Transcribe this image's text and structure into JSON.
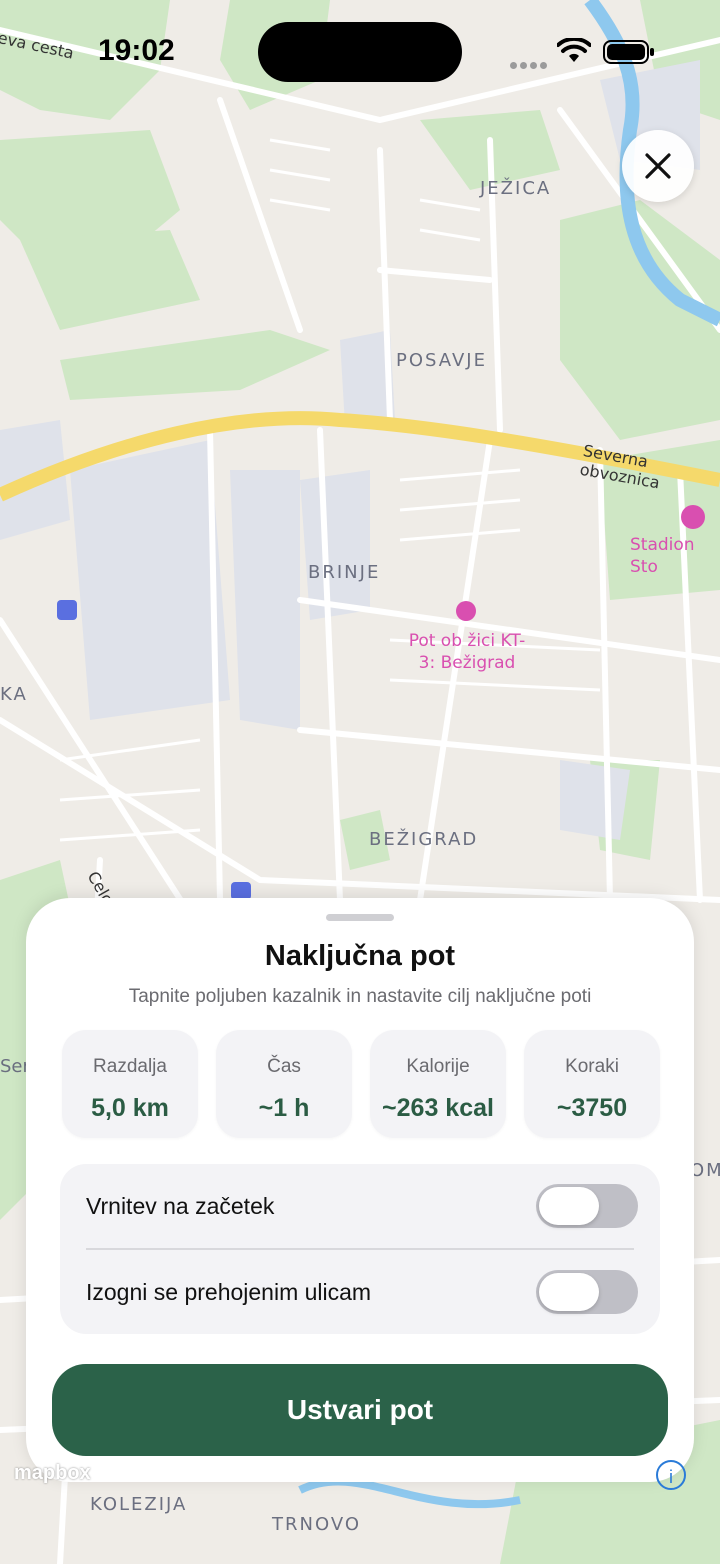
{
  "status_bar": {
    "time": "19:02"
  },
  "map": {
    "district_labels": [
      "JEŽICA",
      "POSAVJE",
      "BRINJE",
      "BEŽIGRAD",
      "KOLEZIJA",
      "TRNOVO"
    ],
    "road_labels": [
      "Severna obvoznica",
      "Celo",
      "eva cesta"
    ],
    "poi_labels": [
      "Stadion Sto",
      "Pot ob žici KT-\n3: Bežigrad"
    ],
    "edge_labels": [
      "KA",
      "Sens",
      "OMA"
    ],
    "colors": {
      "background": "#efece7",
      "park": "#cfe7c5",
      "industrial": "#dfe2ea",
      "highway": "#f5d96b",
      "river": "#8ec8ee"
    }
  },
  "close_button": {
    "icon": "close-icon"
  },
  "sheet": {
    "title": "Naključna pot",
    "subtitle": "Tapnite poljuben kazalnik in nastavite cilj naključne poti",
    "stats": [
      {
        "label": "Razdalja",
        "value": "5,0 km"
      },
      {
        "label": "Čas",
        "value": "~1 h"
      },
      {
        "label": "Kalorije",
        "value": "~263 kcal"
      },
      {
        "label": "Koraki",
        "value": "~3750"
      }
    ],
    "options": [
      {
        "label": "Vrnitev na začetek",
        "enabled": false
      },
      {
        "label": "Izogni se prehojenim ulicam",
        "enabled": false
      }
    ],
    "primary_button": "Ustvari pot",
    "accent_color": "#2b6249"
  },
  "attribution": {
    "logo": "mapbox",
    "info": "i"
  }
}
